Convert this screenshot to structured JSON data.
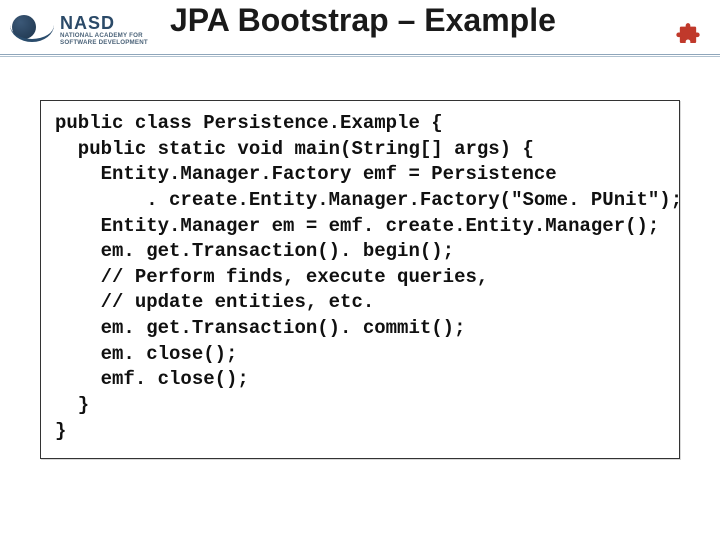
{
  "header": {
    "title": "JPA Bootstrap – Example",
    "logo": {
      "brand": "NASD",
      "tagline_line1": "NATIONAL ACADEMY FOR",
      "tagline_line2": "SOFTWARE DEVELOPMENT"
    },
    "corner_icon": "puzzle-piece-icon"
  },
  "code": {
    "language": "java",
    "lines": [
      "public class Persistence.Example {",
      "  public static void main(String[] args) {",
      "    Entity.Manager.Factory emf = Persistence",
      "        . create.Entity.Manager.Factory(\"Some. PUnit\");",
      "    Entity.Manager em = emf. create.Entity.Manager();",
      "    em. get.Transaction(). begin();",
      "    // Perform finds, execute queries,",
      "    // update entities, etc.",
      "    em. get.Transaction(). commit();",
      "    em. close();",
      "    emf. close();",
      "  }",
      "}"
    ]
  }
}
